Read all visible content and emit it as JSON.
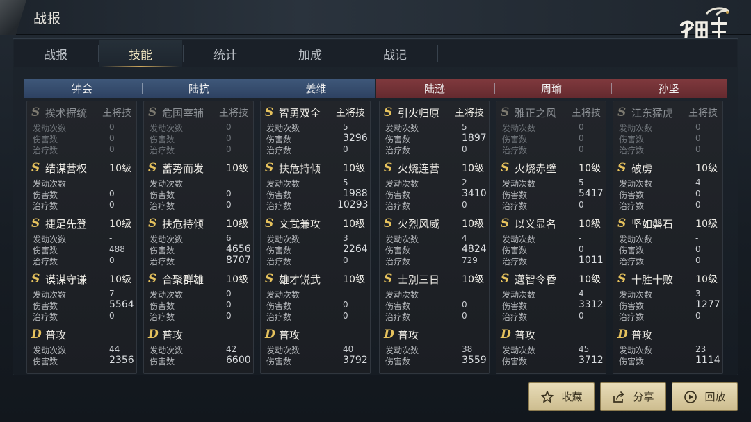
{
  "header": {
    "title": "战报"
  },
  "tabs": [
    {
      "label": "战报",
      "active": false
    },
    {
      "label": "技能",
      "active": true
    },
    {
      "label": "统计",
      "active": false
    },
    {
      "label": "加成",
      "active": false
    },
    {
      "label": "战记",
      "active": false
    }
  ],
  "colors": {
    "allied_header": "#3e5779",
    "enemy_header": "#7f393d",
    "grade_active": "#e6c25d",
    "grade_inactive": "#7d7a70",
    "button_bg": "#e2d4aa"
  },
  "icons": [
    "star-icon",
    "share-icon",
    "play-icon"
  ],
  "stat_labels": {
    "trigger": "发动次数",
    "damage": "伤害数",
    "heal": "治疗数"
  },
  "generals": [
    {
      "name": "钟会",
      "side": "blue",
      "skills": [
        {
          "grade": "S",
          "name": "挨术摒统",
          "level": "主将技",
          "inactive": true,
          "trigger": "0",
          "damage": "0",
          "heal": "0"
        },
        {
          "grade": "S",
          "name": "结谋营权",
          "level": "10级",
          "inactive": false,
          "trigger": "-",
          "damage": "0",
          "heal": "0"
        },
        {
          "grade": "S",
          "name": "捷足先登",
          "level": "10级",
          "inactive": false,
          "trigger": "-",
          "damage": "488",
          "heal": "0"
        },
        {
          "grade": "S",
          "name": "谟谋守谦",
          "level": "10级",
          "inactive": false,
          "trigger": "7",
          "damage": "5564",
          "heal": "0"
        },
        {
          "grade": "D",
          "name": "普攻",
          "level": "",
          "inactive": false,
          "trigger": "44",
          "damage": "2356",
          "heal": null
        }
      ]
    },
    {
      "name": "陆抗",
      "side": "blue",
      "skills": [
        {
          "grade": "S",
          "name": "危国宰辅",
          "level": "主将技",
          "inactive": true,
          "trigger": "0",
          "damage": "0",
          "heal": "0"
        },
        {
          "grade": "S",
          "name": "蓄势而发",
          "level": "10级",
          "inactive": false,
          "trigger": "-",
          "damage": "0",
          "heal": "0"
        },
        {
          "grade": "S",
          "name": "扶危持倾",
          "level": "10级",
          "inactive": false,
          "trigger": "6",
          "damage": "4656",
          "heal": "8707"
        },
        {
          "grade": "S",
          "name": "合聚群雄",
          "level": "10级",
          "inactive": false,
          "trigger": "0",
          "damage": "0",
          "heal": "0"
        },
        {
          "grade": "D",
          "name": "普攻",
          "level": "",
          "inactive": false,
          "trigger": "42",
          "damage": "6600",
          "heal": null
        }
      ]
    },
    {
      "name": "姜维",
      "side": "blue",
      "skills": [
        {
          "grade": "S",
          "name": "智勇双全",
          "level": "主将技",
          "inactive": false,
          "trigger": "5",
          "damage": "3296",
          "heal": "0"
        },
        {
          "grade": "S",
          "name": "扶危持倾",
          "level": "10级",
          "inactive": false,
          "trigger": "5",
          "damage": "1988",
          "heal": "10293"
        },
        {
          "grade": "S",
          "name": "文武兼攻",
          "level": "10级",
          "inactive": false,
          "trigger": "3",
          "damage": "2264",
          "heal": "0"
        },
        {
          "grade": "S",
          "name": "雄才锐武",
          "level": "10级",
          "inactive": false,
          "trigger": "-",
          "damage": "0",
          "heal": "0"
        },
        {
          "grade": "D",
          "name": "普攻",
          "level": "",
          "inactive": false,
          "trigger": "40",
          "damage": "3792",
          "heal": null
        }
      ]
    },
    {
      "name": "陆逊",
      "side": "red",
      "skills": [
        {
          "grade": "S",
          "name": "引火归原",
          "level": "主将技",
          "inactive": false,
          "trigger": "5",
          "damage": "1897",
          "heal": "0"
        },
        {
          "grade": "S",
          "name": "火烧连营",
          "level": "10级",
          "inactive": false,
          "trigger": "2",
          "damage": "3410",
          "heal": "0"
        },
        {
          "grade": "S",
          "name": "火烈风威",
          "level": "10级",
          "inactive": false,
          "trigger": "4",
          "damage": "4824",
          "heal": "729"
        },
        {
          "grade": "S",
          "name": "士别三日",
          "level": "10级",
          "inactive": false,
          "trigger": "-",
          "damage": "0",
          "heal": "0"
        },
        {
          "grade": "D",
          "name": "普攻",
          "level": "",
          "inactive": false,
          "trigger": "38",
          "damage": "3559",
          "heal": null
        }
      ]
    },
    {
      "name": "周瑜",
      "side": "red",
      "skills": [
        {
          "grade": "S",
          "name": "雅正之风",
          "level": "主将技",
          "inactive": true,
          "trigger": "0",
          "damage": "0",
          "heal": "0"
        },
        {
          "grade": "S",
          "name": "火烧赤壁",
          "level": "10级",
          "inactive": false,
          "trigger": "5",
          "damage": "5417",
          "heal": "0"
        },
        {
          "grade": "S",
          "name": "以义显名",
          "level": "10级",
          "inactive": false,
          "trigger": "-",
          "damage": "0",
          "heal": "1011"
        },
        {
          "grade": "S",
          "name": "邁智令昏",
          "level": "10级",
          "inactive": false,
          "trigger": "4",
          "damage": "3312",
          "heal": "0"
        },
        {
          "grade": "D",
          "name": "普攻",
          "level": "",
          "inactive": false,
          "trigger": "45",
          "damage": "3712",
          "heal": null
        }
      ]
    },
    {
      "name": "孙坚",
      "side": "red",
      "skills": [
        {
          "grade": "S",
          "name": "江东猛虎",
          "level": "主将技",
          "inactive": true,
          "trigger": "0",
          "damage": "0",
          "heal": "0"
        },
        {
          "grade": "S",
          "name": "破虏",
          "level": "10级",
          "inactive": false,
          "trigger": "4",
          "damage": "0",
          "heal": "0"
        },
        {
          "grade": "S",
          "name": "坚如磐石",
          "level": "10级",
          "inactive": false,
          "trigger": "-",
          "damage": "0",
          "heal": "0"
        },
        {
          "grade": "S",
          "name": "十胜十败",
          "level": "10级",
          "inactive": false,
          "trigger": "3",
          "damage": "1277",
          "heal": "0"
        },
        {
          "grade": "D",
          "name": "普攻",
          "level": "",
          "inactive": false,
          "trigger": "23",
          "damage": "1114",
          "heal": null
        }
      ]
    }
  ],
  "actions": [
    {
      "label": "收藏",
      "icon": "star-icon"
    },
    {
      "label": "分享",
      "icon": "share-icon"
    },
    {
      "label": "回放",
      "icon": "play-icon"
    }
  ]
}
